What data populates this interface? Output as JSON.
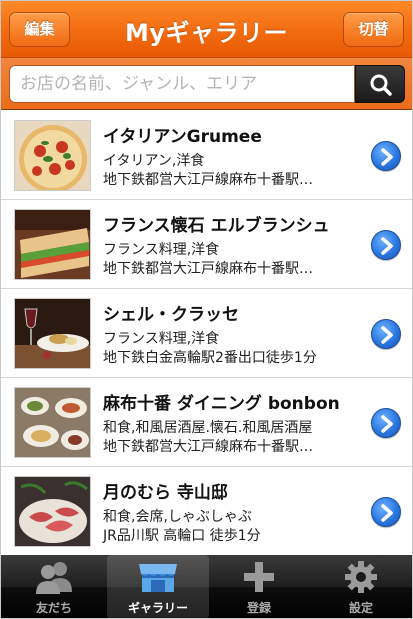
{
  "header": {
    "title": "Myギャラリー",
    "edit_label": "編集",
    "switch_label": "切替"
  },
  "search": {
    "placeholder": "お店の名前、ジャンル、エリア",
    "value": "",
    "icon": "search-icon"
  },
  "restaurants": [
    {
      "name": "イタリアンGrumee",
      "genre": "イタリアン,洋食",
      "access": "地下鉄都営大江戸線麻布十番駅…",
      "thumb": "pizza"
    },
    {
      "name": "フランス懐石 エルブランシュ",
      "genre": "フランス料理,洋食",
      "access": "地下鉄都営大江戸線麻布十番駅…",
      "thumb": "sandwich"
    },
    {
      "name": "シェル・クラッセ",
      "genre": "フランス料理,洋食",
      "access": "地下鉄白金高輪駅2番出口徒歩1分",
      "thumb": "wine-dish"
    },
    {
      "name": "麻布十番 ダイニング bonbon",
      "genre": "和食,和風居酒屋.懐石.和風居酒屋",
      "access": "地下鉄都営大江戸線麻布十番駅…",
      "thumb": "table-spread"
    },
    {
      "name": "月のむら 寺山邸",
      "genre": "和食,会席,しゃぶしゃぶ",
      "access": "JR品川駅 高輪口 徒歩1分",
      "thumb": "shabu"
    }
  ],
  "tabs": [
    {
      "label": "友だち",
      "icon": "friends-icon",
      "active": false
    },
    {
      "label": "ギャラリー",
      "icon": "gallery-store-icon",
      "active": true
    },
    {
      "label": "登録",
      "icon": "plus-icon",
      "active": false
    },
    {
      "label": "設定",
      "icon": "gear-icon",
      "active": false
    }
  ],
  "colors": {
    "header_orange": "#f26b0f",
    "chevron_blue": "#2a78e0",
    "tab_active": "#ffffff"
  }
}
